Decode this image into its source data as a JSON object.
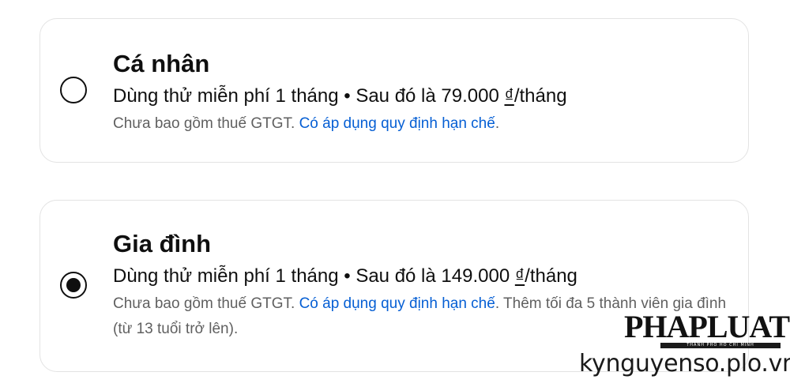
{
  "plans": [
    {
      "title": "Cá nhân",
      "selected": false,
      "price_prefix": "Dùng thử miễn phí 1 tháng • Sau đó là 79.000 ",
      "currency": "₫",
      "price_suffix": "/tháng",
      "note_text": "Chưa bao gồm thuế GTGT. ",
      "note_link": "Có áp dụng quy định hạn chế",
      "note_tail": "."
    },
    {
      "title": "Gia đình",
      "selected": true,
      "price_prefix": "Dùng thử miễn phí 1 tháng • Sau đó là 149.000 ",
      "currency": "₫",
      "price_suffix": "/tháng",
      "note_text": "Chưa bao gồm thuế GTGT. ",
      "note_link": "Có áp dụng quy định hạn chế",
      "note_tail": ". Thêm tối đa 5 thành viên gia đình (từ 13 tuổi trở lên)."
    }
  ],
  "watermark": {
    "logo": "PHAPLUAT",
    "logo_sub": "THÀNH PHỐ HỒ CHÍ MINH",
    "url": "kynguyenso.plo.vn"
  },
  "colors": {
    "link": "#065fd4",
    "note": "#606060",
    "border": "#e3e3e3"
  }
}
